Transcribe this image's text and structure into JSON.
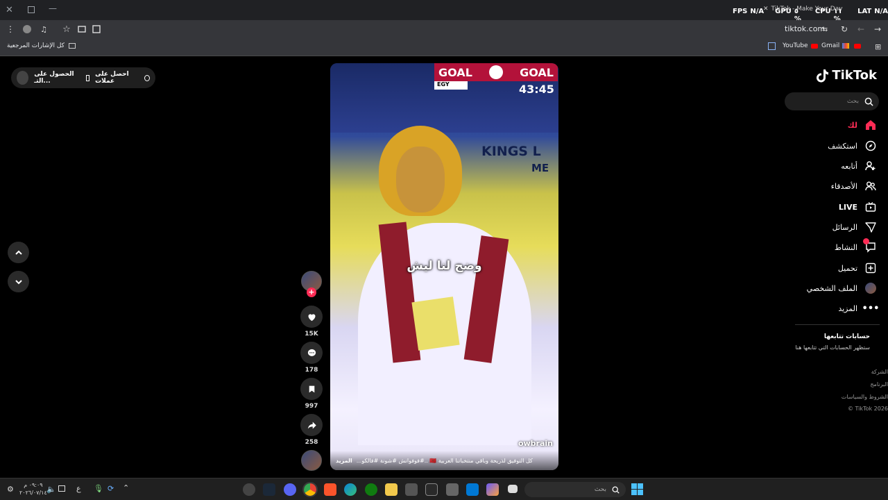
{
  "browser": {
    "tab_title": "TikTok - Make Your Day",
    "url": "tiktok.com",
    "bookmarks_folder": "كل الإشارات المرجعية",
    "bookmarks": [
      "YouTube",
      "Gmail"
    ],
    "overlay": {
      "fps_label": "FPS",
      "fps_value": "N/A",
      "gpu_label": "GPU",
      "gpu_value": "٥ %",
      "cpu_label": "CPU",
      "cpu_value": "١١ %",
      "lat_label": "LAT",
      "lat_value": "N/A"
    }
  },
  "promo": {
    "get_app": "احصل على عملات",
    "get_coins": "الحصول على التـ..."
  },
  "video": {
    "scoreboard_left": "GOAL",
    "scoreboard_right": "GOAL",
    "team": "EGY",
    "timer": "43:45",
    "banner_line1": "KINGS L",
    "banner_line2": "ME",
    "subtitle": "وضح لنا ليش",
    "watermark": "owbrain",
    "caption": "كل التوفيق لذريحة وباقي منتخباتنا العربية 🇲🇦 ..#فوفوانش #شونة #فالكو...",
    "more": "المزيد"
  },
  "actions": {
    "likes": "15K",
    "comments": "178",
    "saves": "997",
    "shares": "258"
  },
  "sidebar": {
    "logo": "TikTok",
    "search_placeholder": "بحث",
    "items": [
      {
        "label": "لك",
        "icon": "home-icon"
      },
      {
        "label": "استكشف",
        "icon": "compass-icon"
      },
      {
        "label": "أتابعه",
        "icon": "user-follow-icon"
      },
      {
        "label": "الأصدقاء",
        "icon": "friends-icon"
      },
      {
        "label": "LIVE",
        "icon": "live-icon"
      },
      {
        "label": "الرسائل",
        "icon": "messages-icon"
      },
      {
        "label": "النشاط",
        "icon": "activity-icon"
      },
      {
        "label": "تحميل",
        "icon": "upload-icon"
      },
      {
        "label": "الملف الشخصي",
        "icon": "profile-icon"
      },
      {
        "label": "المزيد",
        "icon": "more-icon"
      }
    ],
    "following_title": "حسابات تتابعها",
    "following_empty": "ستظهر الحسابات التي تتابعها هنا",
    "footer": [
      "الشركة",
      "البرنامج",
      "الشروط والسياسات",
      "© TikTok 2026"
    ]
  },
  "taskbar": {
    "search_placeholder": "بحث",
    "time": "٠٩:٠٩ م",
    "date": "٢٠٢٦/٠٧/١٤",
    "lang": "ع"
  },
  "colors": {
    "accent": "#fe2c55",
    "chrome_bg": "#35363a",
    "titlebar_bg": "#202124"
  }
}
